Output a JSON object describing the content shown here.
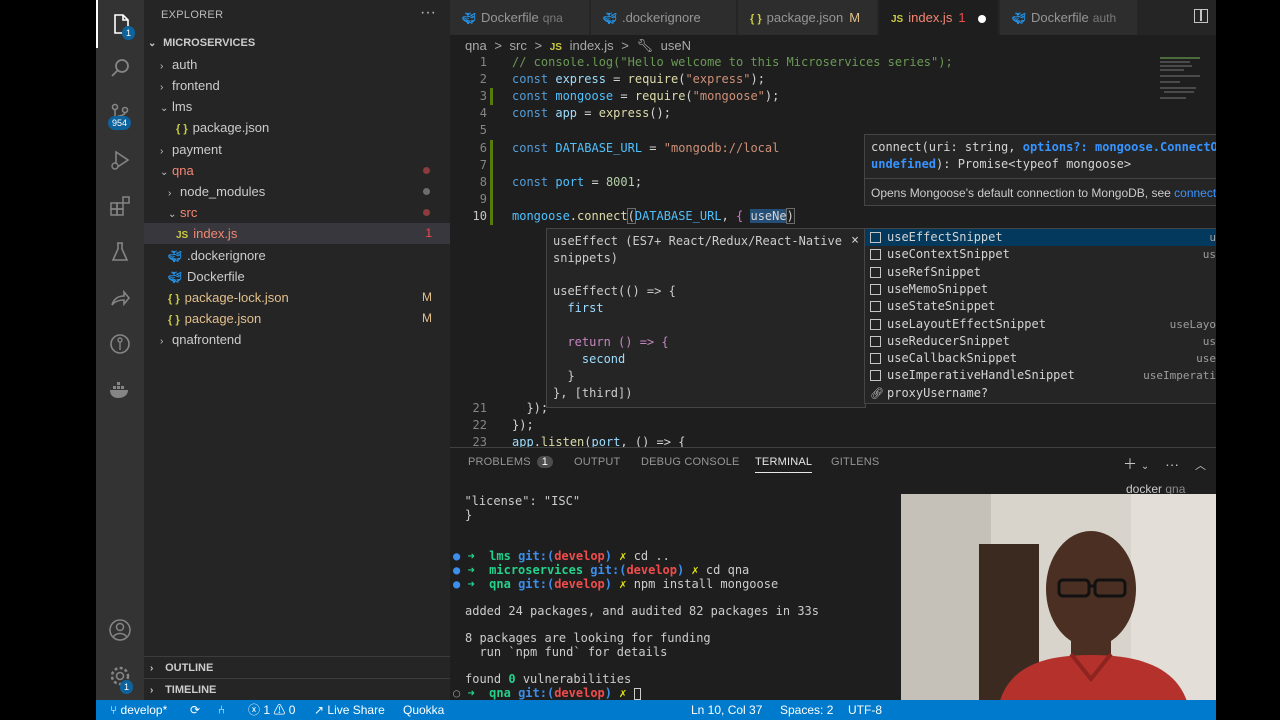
{
  "activity_bar": {
    "explorer_badge": "1",
    "source_control_badge": "954",
    "settings_badge": "1"
  },
  "explorer": {
    "title": "EXPLORER",
    "more": "···",
    "root": "MICROSERVICES",
    "items": [
      {
        "label": "auth",
        "kind": "folder",
        "expanded": false
      },
      {
        "label": "frontend",
        "kind": "folder",
        "expanded": false
      },
      {
        "label": "lms",
        "kind": "folder",
        "expanded": true
      },
      {
        "label": "package.json",
        "kind": "json",
        "icon": "{ }"
      },
      {
        "label": "payment",
        "kind": "folder",
        "expanded": false
      },
      {
        "label": "qna",
        "kind": "folder",
        "expanded": true
      },
      {
        "label": "node_modules",
        "kind": "folder",
        "expanded": false
      },
      {
        "label": "src",
        "kind": "folder",
        "expanded": true
      },
      {
        "label": "index.js",
        "kind": "js",
        "icon": "JS",
        "status": "1"
      },
      {
        "label": ".dockerignore",
        "kind": "docker"
      },
      {
        "label": "Dockerfile",
        "kind": "docker"
      },
      {
        "label": "package-lock.json",
        "kind": "json",
        "icon": "{ }",
        "status": "M"
      },
      {
        "label": "package.json",
        "kind": "json",
        "icon": "{ }",
        "status": "M"
      },
      {
        "label": "qnafrontend",
        "kind": "folder",
        "expanded": false
      }
    ],
    "outline": "OUTLINE",
    "timeline": "TIMELINE"
  },
  "tabs": [
    {
      "label": "Dockerfile",
      "sub": "qna"
    },
    {
      "label": ".dockerignore"
    },
    {
      "label": "package.json",
      "icon": "{ }",
      "flag": "M"
    },
    {
      "label": "index.js",
      "icon": "JS",
      "flag": "1",
      "active": true
    },
    {
      "label": "Dockerfile",
      "sub": "auth"
    }
  ],
  "breadcrumb": {
    "parts": [
      "qna",
      ">",
      "src",
      ">",
      "JS",
      "index.js",
      ">",
      "useN"
    ]
  },
  "editor": {
    "line_numbers": [
      "1",
      "2",
      "3",
      "4",
      "5",
      "6",
      "7",
      "8",
      "9",
      "10",
      "21",
      "22",
      "23"
    ],
    "lines": {
      "l1_comment": "// console.log(\"Hello welcome to this Microservices series\");",
      "l2_kw": "const",
      "l2_var": "express",
      "l2_op": " = ",
      "l2_fn": "require",
      "l2_str": "\"express\"",
      "l2_end": ");",
      "l3_kw": "const",
      "l3_var": "mongoose",
      "l3_op": " = ",
      "l3_fn": "require",
      "l3_str": "\"mongoose\"",
      "l3_end": ");",
      "l4_kw": "const",
      "l4_var": "app",
      "l4_op": " = ",
      "l4_fn": "express",
      "l4_end": "();",
      "l6_kw": "const",
      "l6_var": "DATABASE_URL",
      "l6_op": " = ",
      "l6_str": "\"mongodb://local",
      "l8_kw": "const",
      "l8_var": "port",
      "l8_op": " = ",
      "l8_num": "8001",
      "l8_end": ";",
      "l10_var": "mongoose",
      "l10_dot": ".",
      "l10_fn": "connect",
      "l10_p": "(",
      "l10_arg": "DATABASE_URL",
      "l10_comma": ", ",
      "l10_brace": "{",
      "l10_typed": "useNe",
      "l10_close": ")",
      "l21": "  });",
      "l22": "});",
      "l23_var": "app",
      "l23_dot": ".",
      "l23_fn": "listen",
      "l23_p": "(",
      "l23_arg": "port",
      "l23_rest": ", () => {"
    }
  },
  "signature_help": {
    "line1_a": "connect(uri: string, ",
    "line1_b": "options?: mongoose.ConnectOptions |",
    "line2_a": "undefined",
    "line2_b": "): Promise<typeof mongoose>",
    "doc": "Opens Mongoose's default connection to MongoDB, see ",
    "doc_link": "connections docs"
  },
  "suggest_details": {
    "header": "useEffect (ES7+ React/Redux/React-Native snippets)",
    "close": "×",
    "body": [
      "useEffect(() => {",
      "  first",
      "",
      "  return () => {",
      "    second",
      "  }",
      "}, [third])"
    ]
  },
  "suggest": [
    {
      "label": "useEffectSnippet",
      "detail": "useEffect",
      "selected": true
    },
    {
      "label": "useContextSnippet",
      "detail": "useContext"
    },
    {
      "label": "useRefSnippet",
      "detail": "useRef"
    },
    {
      "label": "useMemoSnippet",
      "detail": "useMemo"
    },
    {
      "label": "useStateSnippet",
      "detail": "useState"
    },
    {
      "label": "useLayoutEffectSnippet",
      "detail": "useLayoutEffect"
    },
    {
      "label": "useReducerSnippet",
      "detail": "useReducer"
    },
    {
      "label": "useCallbackSnippet",
      "detail": "useCallback"
    },
    {
      "label": "useImperativeHandleSnippet",
      "detail": "useImperativeHandle"
    },
    {
      "label": "proxyUsername?",
      "detail": ""
    }
  ],
  "panel": {
    "tabs": [
      "PROBLEMS",
      "OUTPUT",
      "DEBUG CONSOLE",
      "TERMINAL",
      "GITLENS"
    ],
    "problems_count": "1",
    "terminal_lines": {
      "t1": "  \"license\": \"ISC\"",
      "t2": "}",
      "t3_dir": "lms",
      "t3_git": " git:(",
      "t3_branch": "develop",
      "t3_close": ")",
      "t3_x": " ✗",
      "t3_cmd": " cd ..",
      "t4_dir": "microservices",
      "t4_git": " git:(",
      "t4_branch": "develop",
      "t4_close": ")",
      "t4_x": " ✗",
      "t4_cmd": " cd qna",
      "t5_dir": "qna",
      "t5_git": " git:(",
      "t5_branch": "develop",
      "t5_close": ")",
      "t5_x": " ✗",
      "t5_cmd": " npm install mongoose",
      "t6": "added 24 packages, and audited 82 packages in 33s",
      "t7": "8 packages are looking for funding",
      "t8": "  run `npm fund` for details",
      "t9_a": "found ",
      "t9_num": "0",
      "t9_b": " vulnerabilities",
      "t10_dir": "qna",
      "t10_git": " git:(",
      "t10_branch": "develop",
      "t10_close": ")",
      "t10_x": " ✗"
    },
    "docker_tab": "docker",
    "docker_sub": "qna"
  },
  "status_bar": {
    "branch": "develop*",
    "errors": "1",
    "warnings": "0",
    "live_share": "Live Share",
    "quokka": "Quokka",
    "position": "Ln 10, Col 37",
    "spaces": "Spaces: 2",
    "encoding": "UTF-8"
  }
}
